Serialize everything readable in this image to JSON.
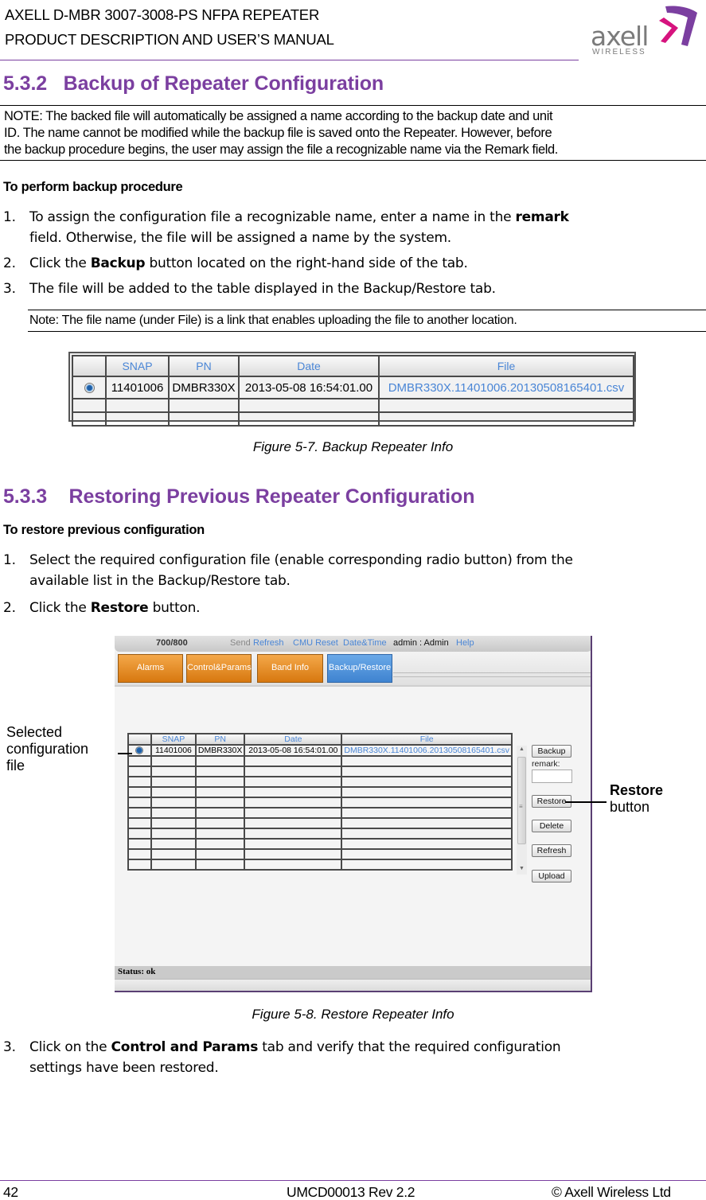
{
  "header": {
    "line1": "AXELL D-MBR 3007-3008-PS NFPA REPEATER",
    "line2": "PRODUCT DESCRIPTION AND USER’S MANUAL",
    "logo_word": "axell",
    "logo_sub": "WIRELESS",
    "accent_color": "#7b3fa0",
    "logo_magenta": "#d6137e"
  },
  "section_532": {
    "number": "5.3.2",
    "title": "Backup of Repeater Configuration",
    "note": [
      "NOTE: The backed file will automatically be assigned a name according to the backup date and unit",
      "ID. The name cannot be modified while the backup file is saved onto the Repeater. However, before",
      "the backup procedure begins, the user may assign the file a recognizable name via the Remark field."
    ],
    "procedure_title": "To perform backup procedure",
    "steps": [
      {
        "num": "1.",
        "pre": "To assign the configuration file a recognizable name, enter a name in the ",
        "bold": "remark",
        "post": "",
        "line2": "field. Otherwise, the file will be assigned a name by the system."
      },
      {
        "num": "2.",
        "pre": "Click the ",
        "bold": "Backup",
        "post": " button located on the right-hand side of the tab."
      },
      {
        "num": "3.",
        "pre": "The file will be added to the table displayed in the Backup/Restore tab.",
        "bold": "",
        "post": ""
      }
    ],
    "note2": "Note: The file name (under File) is a link that enables uploading the file to another location.",
    "figure_caption": "Figure 5-7. Backup Repeater Info"
  },
  "backup_table": {
    "columns": [
      "",
      "SNAP",
      "PN",
      "Date",
      "File"
    ],
    "rows": [
      {
        "selected": true,
        "snap": "11401006",
        "pn": "DMBR330X",
        "date": "2013-05-08 16:54:01.00",
        "file": "DMBR330X.11401006.20130508165401.csv"
      }
    ],
    "empty_rows": 2
  },
  "section_533": {
    "number": "5.3.3",
    "title": "Restoring Previous Repeater Configuration",
    "procedure_title": "To restore previous configuration",
    "steps": [
      {
        "num": "1.",
        "pre": "Select the required configuration file (enable corresponding radio button) from the",
        "line2": "available list in the Backup/Restore tab."
      },
      {
        "num": "2.",
        "pre": "Click the ",
        "bold": "Restore",
        "post": " button."
      }
    ],
    "figure_caption": "Figure 5-8. Restore Repeater Info",
    "step3": {
      "num": "3.",
      "pre": "Click on the ",
      "bold": "Control and Params",
      "post": " tab and verify that the required configuration",
      "line2": "settings have been restored."
    }
  },
  "restore_screen": {
    "topbar": {
      "band": "700/800",
      "send": "Send",
      "refresh": "Refresh",
      "cmu_reset": "CMU Reset",
      "date_time": "Date&Time",
      "user": "admin : Admin",
      "help": "Help"
    },
    "tabs": [
      {
        "label": "Alarms",
        "active": false
      },
      {
        "label": "Control&Params",
        "active": false
      },
      {
        "label": "Band Info",
        "active": false
      },
      {
        "label": "Backup/Restore",
        "active": true
      }
    ],
    "table": {
      "columns": [
        "",
        "SNAP",
        "PN",
        "Date",
        "File"
      ],
      "rows": [
        {
          "selected": true,
          "snap": "11401006",
          "pn": "DMBR330X",
          "date": "2013-05-08 16:54:01.00",
          "file": "DMBR330X.11401006.20130508165401.csv"
        }
      ],
      "empty_rows": 11
    },
    "buttons": {
      "backup": "Backup",
      "remark_label": "remark:",
      "remark_value": "",
      "restore": "Restore",
      "delete": "Delete",
      "refresh": "Refresh",
      "upload": "Upload"
    },
    "status": "Status: ok",
    "tab_orange": "#e38a22",
    "tab_blue": "#4a8fd8",
    "link_color": "#4a86d6"
  },
  "callouts": {
    "selected_file": [
      "Selected",
      "configuration",
      "file"
    ],
    "restore_bold": "Restore",
    "restore_rest": "button"
  },
  "footer": {
    "page": "42",
    "doc": "UMCD00013 Rev 2.2",
    "copyright": "© Axell Wireless Ltd"
  }
}
